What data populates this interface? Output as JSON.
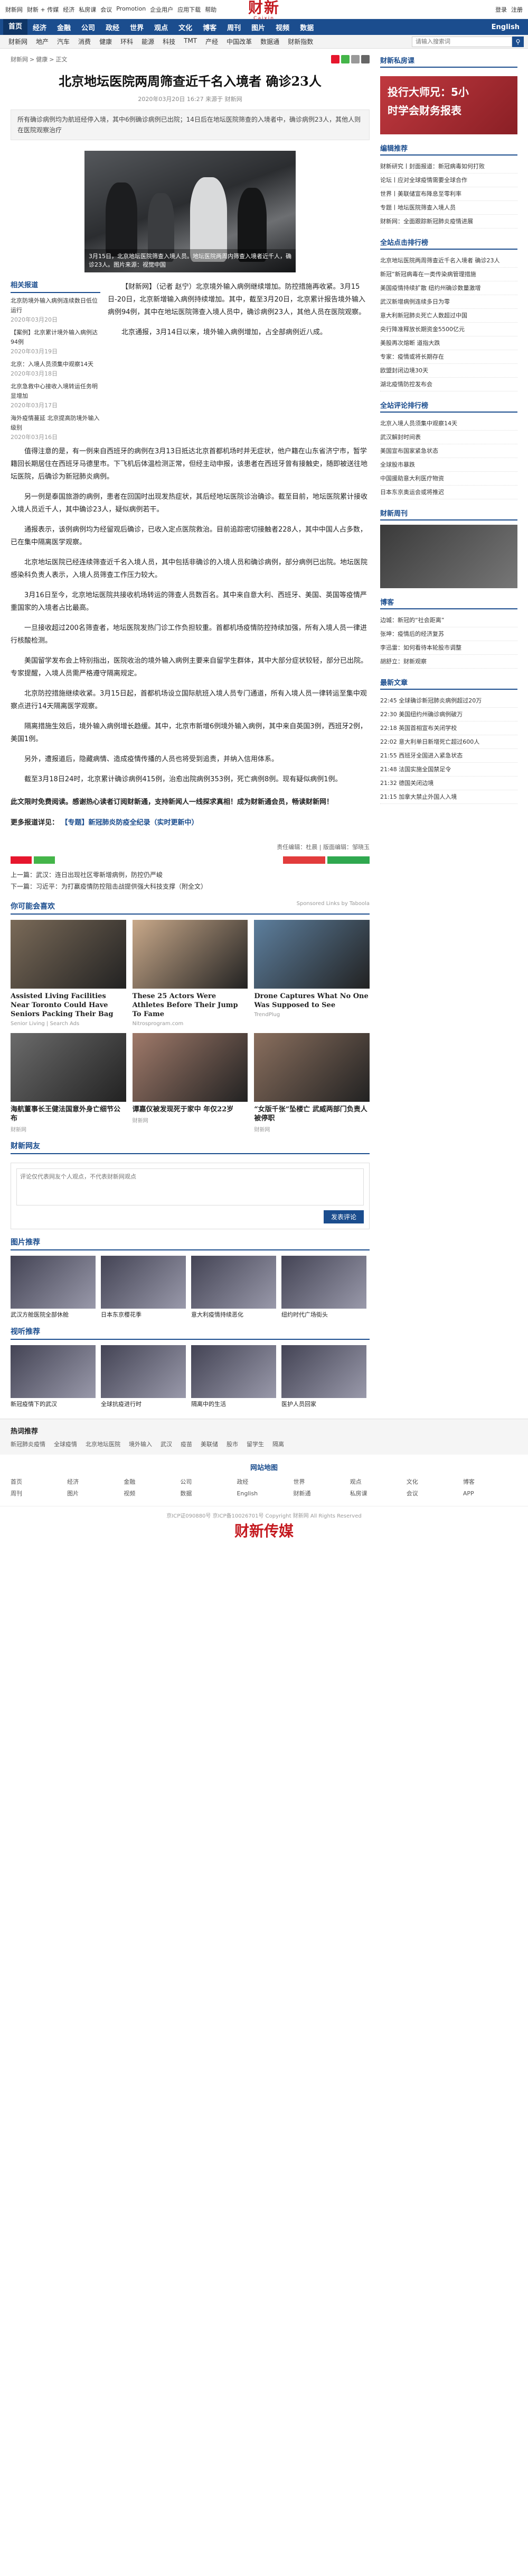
{
  "topbar": {
    "links": [
      "财新网",
      "财新 + 传媒",
      "经济",
      "私房课",
      "会议",
      "Promotion",
      "企业用户",
      "应用下载",
      "帮助"
    ],
    "brand_cn": "财新",
    "brand_en": "Caixin",
    "login": "登录",
    "register": "注册"
  },
  "nav": {
    "items": [
      "首页",
      "经济",
      "金融",
      "公司",
      "政经",
      "世界",
      "观点",
      "文化",
      "博客",
      "周刊",
      "图片",
      "视频",
      "数据"
    ],
    "right": [
      "English"
    ]
  },
  "subnav": {
    "items": [
      "财新网",
      "地产",
      "汽车",
      "消费",
      "健康",
      "环科",
      "能源",
      "科技",
      "TMT",
      "产经",
      "中国改革",
      "数据通",
      "财新指数"
    ],
    "search_placeholder": "请输入搜索词",
    "search_icon": "search-icon"
  },
  "breadcrumb": [
    "财新网",
    ">",
    "健康",
    ">",
    "正文"
  ],
  "article": {
    "title": "北京地坛医院两周筛查近千名入境者 确诊23人",
    "meta": "2020年03月20日 16:27 来源于 财新网",
    "summary": "所有确诊病例均为航班经停入境，其中6例确诊病例已出院；14日后在地坛医院筛查的入境者中，确诊病例23人，其他人则在医院观察治疗",
    "photo_caption": "3月15日，北京地坛医院筛查入境人员。地坛医院两周内筛查入境者近千人，确诊23人。图片来源：视觉中国",
    "lead": [
      "【财新网】（记者 赵宁）北京境外输入病例继续增加。防控措施再收紧。3月15日-20日，北京新增输入病例持续增加。其中，截至3月20日，北京累计报告境外输入病例94例，其中在地坛医院筛查入境人员中，确诊病例23人，其他人员在医院观察。",
      "北京通报，3月14日以来，境外输入病例增加，占全部病例近八成。"
    ],
    "paragraphs": [
      "值得注意的是，有一例来自西班牙的病例在3月13日抵达北京首都机场时并无症状，他户籍在山东省济宁市，暂学籍回长期居住在西班牙马德里市。下飞机后体温检测正常，但经主动申报，该患者在西班牙曾有接触史，随即被送往地坛医院，后确诊为新冠肺炎病例。",
      "另一例是泰国旅游的病例，患者在回国时出现发热症状，其后经地坛医院诊治确诊。截至目前，地坛医院累计接收入境人员近千人，其中确诊23人，疑似病例若干。",
      "通报表示，该例病例均为经留观后确诊，已收入定点医院救治。目前追踪密切接触者228人，其中中国人占多数，已在集中隔离医学观察。",
      "北京地坛医院已经连续筛查近千名入境人员，其中包括非确诊的入境人员和确诊病例，部分病例已出院。地坛医院感染科负责人表示，入境人员筛查工作压力较大。",
      "3月16日至今，北京地坛医院共接收机场转运的筛查人员数百名。其中来自意大利、西班牙、美国、英国等疫情严重国家的入境者占比最高。",
      "一旦接收超过200名筛查者，地坛医院发热门诊工作负担较重。首都机场疫情防控持续加强，所有入境人员一律进行核酸检测。",
      "美国留学发布会上特别指出，医院收治的境外输入病例主要来自留学生群体，其中大部分症状较轻，部分已出院。专家提醒，入境人员需严格遵守隔离规定。",
      "北京防控措施继续收紧。3月15日起，首都机场设立国际航班入境人员专门通道，所有入境人员一律转运至集中观察点进行14天隔离医学观察。",
      "隔离措施生效后，境外输入病例增长趋缓。其中，北京市新增6例境外输入病例，其中来自英国3例，西班牙2例，美国1例。",
      "另外，遭报道后，隐藏病情、造成疫情传播的人员也将受到追责，并纳入信用体系。",
      "截至3月18日24时，北京累计确诊病例415例，治愈出院病例353例，死亡病例8例。现有疑似病例1例。"
    ],
    "note": "此文限时免费阅读。感谢热心读者订阅财新通，支持新闻人一线探求真相！成为财新通会员，畅读财新网！",
    "more": "更多报道详见：",
    "topic_link": "【专题】新冠肺炎防疫全纪录（实时更新中）",
    "editor": "责任编辑：杜晨 | 版面编辑：邹晓玉",
    "prev": "上一篇：武汉：连日出现社区零新增病例，防控仍严峻",
    "next": "下一篇：习近平：为打赢疫情防控阻击战提供强大科技支撑（附全文）"
  },
  "related": {
    "title": "相关报道",
    "items": [
      {
        "t": "北京防境外输入病例连续数日低位运行",
        "d": "2020年03月20日"
      },
      {
        "t": "【案例】北京累计境外输入病例达94例",
        "d": "2020年03月19日"
      },
      {
        "t": "北京：入境人员须集中观察14天",
        "d": "2020年03月18日"
      },
      {
        "t": "北京急救中心接收入境转运任务明显增加",
        "d": "2020年03月17日"
      },
      {
        "t": "海外疫情蔓延 北京提高防境外输入级别",
        "d": "2020年03月16日"
      }
    ]
  },
  "ads": {
    "header": "你可能会喜欢",
    "sponsored": "Sponsored Links by Taboola",
    "items": [
      {
        "t": "Assisted Living Facilities Near Toronto Could Have Seniors Packing Their Bag",
        "s": "Senior Living | Search Ads"
      },
      {
        "t": "These 25 Actors Were Athletes Before Their Jump To Fame",
        "s": "Nitrosprogram.com"
      },
      {
        "t": "Drone Captures What No One Was Supposed to See",
        "s": "TrendPlug"
      },
      {
        "t": "海航董事长王健法国意外身亡细节公布",
        "s": "财新网"
      },
      {
        "t": "谭嘉仪被发现死于家中 年仅22岁",
        "s": "财新网"
      },
      {
        "t": "“女版千张”坠楼亡 武威两部门负责人被停职",
        "s": "财新网"
      }
    ]
  },
  "comments": {
    "header": "财新网友",
    "placeholder": "评论仅代表网友个人观点，不代表财新网观点",
    "submit": "发表评论",
    "count": "0"
  },
  "gallery": {
    "header": "图片推荐",
    "items": [
      "武汉方舱医院全部休舱",
      "日本东京樱花季",
      "意大利疫情持续恶化",
      "纽约时代广场街头"
    ]
  },
  "video": {
    "header": "视听推荐",
    "items": [
      "新冠疫情下的武汉",
      "全球抗疫进行时",
      "隔离中的生活",
      "医护人员回家"
    ]
  },
  "sidebar": {
    "app_title": "财新私房课",
    "ad_line1": "投行大师兄：5小",
    "ad_line2": "时学会财务报表",
    "editor_title": "编辑推荐",
    "editor_items": [
      "财新研究丨封面报道：新冠病毒如何打败",
      "论坛丨应对全球疫情需要全球合作",
      "世界丨美联储宣布降息至零利率",
      "专题丨地坛医院筛查入境人员",
      "财新网：全面跟踪新冠肺炎疫情进展"
    ],
    "latest_title": "全站点击排行榜",
    "latest_tabs": [
      "48小时",
      "一周"
    ],
    "latest_items": [
      "北京地坛医院两周筛查近千名入境者 确诊23人",
      "新冠”新冠病毒在一类传染病管理措施",
      "美国疫情持续扩散 纽约州确诊数量激增",
      "武汉新增病例连续多日为零",
      "意大利新冠肺炎死亡人数超过中国",
      "央行降准释放长期资金5500亿元",
      "美股再次熔断 道指大跌",
      "专家：疫情或将长期存在",
      "欧盟封闭边境30天",
      "湖北疫情防控发布会"
    ],
    "comment_title": "全站评论排行榜",
    "comment_items": [
      "北京入境人员须集中观察14天",
      "武汉解封时间表",
      "美国宣布国家紧急状态",
      "全球股市暴跌",
      "中国援助意大利医疗物资",
      "日本东京奥运会或将推迟"
    ],
    "weekly_title": "财新周刊",
    "blog_title": "博客",
    "blog_items": [
      "边城：新冠的“社会距离”",
      "张坤：疫情后的经济复苏",
      "李迅雷：如何看待本轮股市调整",
      "胡舒立：财新观察"
    ],
    "latest_news_title": "最新文章",
    "news_items": [
      "22:45 全球确诊新冠肺炎病例超过20万",
      "22:30 美国纽约州确诊病例破万",
      "22:18 英国首相宣布关闭学校",
      "22:02 意大利单日新增死亡超过600人",
      "21:55 西班牙全国进入紧急状态",
      "21:48 法国实施全国禁足令",
      "21:32 德国关闭边境",
      "21:15 加拿大禁止外国人入境"
    ]
  },
  "footer": {
    "hot_title": "热词推荐",
    "hot": [
      "新冠肺炎疫情",
      "全球疫情",
      "北京地坛医院",
      "境外输入",
      "武汉",
      "疫苗",
      "美联储",
      "股市",
      "留学生",
      "隔离"
    ],
    "sitemap_title": "网站地图",
    "sitemap": [
      "首页",
      "经济",
      "金融",
      "公司",
      "政经",
      "世界",
      "观点",
      "文化",
      "博客",
      "周刊",
      "图片",
      "视频",
      "数据",
      "English",
      "财新通",
      "私房课",
      "会议",
      "APP"
    ],
    "copyright": "京ICP证090880号 京ICP备10026701号 Copyright 财新网 All Rights Reserved",
    "bottom_logo": "财新传媒"
  }
}
